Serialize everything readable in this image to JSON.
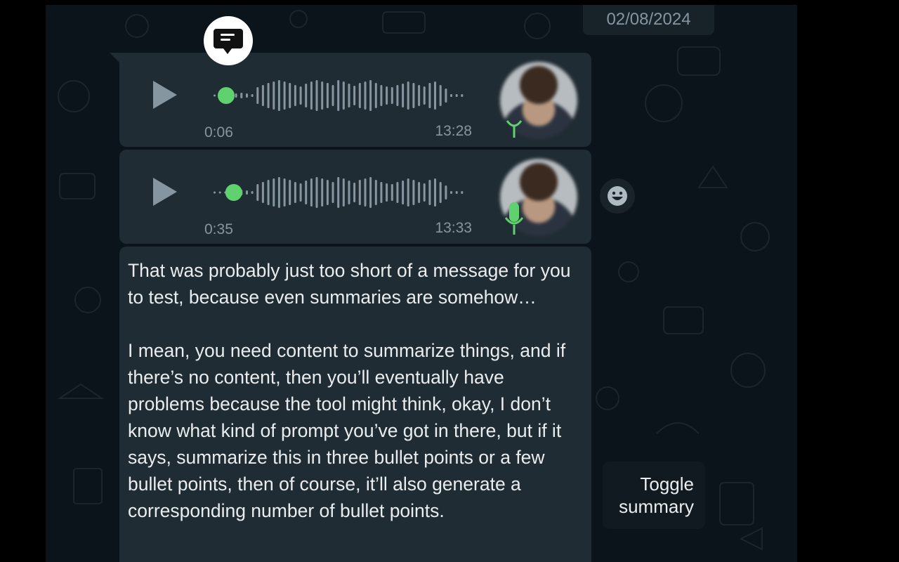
{
  "chat": {
    "date_chip": "02/08/2024",
    "voice_messages": [
      {
        "elapsed": "0:06",
        "time": "13:28",
        "progress": 0.05
      },
      {
        "elapsed": "0:35",
        "time": "13:33",
        "progress": 0.08
      }
    ],
    "text_message": "That was probably just too short of a message for you to test, because even summaries are somehow…\n\nI mean, you need content to summarize things, and if there’s no content, then you’ll eventually have problems because the tool might think, okay, I don’t know what kind of prompt you’ve got in there, but if it says, summarize this in three bullet points or a few bullet points, then of course, it’ll also generate a corresponding number of bullet points."
  },
  "tooltip": {
    "label": "Toggle summary"
  },
  "icons": {
    "summary": "summary-message-icon",
    "play": "play-icon",
    "mic": "microphone-icon",
    "emoji": "emoji-smiley-icon"
  },
  "colors": {
    "accent_green": "#5fd16e",
    "bubble": "#202c33",
    "background": "#0b141a",
    "text": "#e9edef",
    "muted": "#8696a0"
  }
}
